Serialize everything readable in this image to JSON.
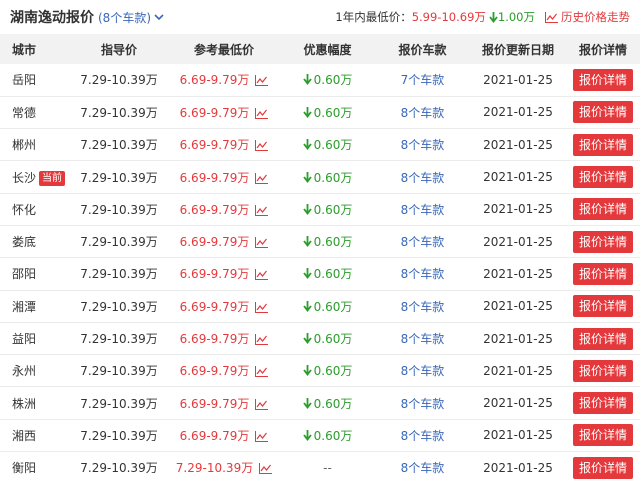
{
  "header": {
    "title": "湖南逸动报价",
    "model_count": "(8个车款)",
    "year_low_label": "1年内最低价：",
    "year_low_range": "5.99-10.69万",
    "year_drop": "1.00万",
    "history_link": "历史价格走势"
  },
  "colors": {
    "accent": "#e4393c",
    "link": "#3a67b8",
    "down": "#2a9d2a"
  },
  "columns": [
    "城市",
    "指导价",
    "参考最低价",
    "优惠幅度",
    "报价车款",
    "报价更新日期",
    "报价详情"
  ],
  "rows": [
    {
      "city": "岳阳",
      "badge": "",
      "guide": "7.29-10.39万",
      "low": "6.69-9.79万",
      "discount": "0.60万",
      "models": "7个车款",
      "date": "2021-01-25",
      "action": "报价详情"
    },
    {
      "city": "常德",
      "badge": "",
      "guide": "7.29-10.39万",
      "low": "6.69-9.79万",
      "discount": "0.60万",
      "models": "8个车款",
      "date": "2021-01-25",
      "action": "报价详情"
    },
    {
      "city": "郴州",
      "badge": "",
      "guide": "7.29-10.39万",
      "low": "6.69-9.79万",
      "discount": "0.60万",
      "models": "8个车款",
      "date": "2021-01-25",
      "action": "报价详情"
    },
    {
      "city": "长沙",
      "badge": "当前",
      "guide": "7.29-10.39万",
      "low": "6.69-9.79万",
      "discount": "0.60万",
      "models": "8个车款",
      "date": "2021-01-25",
      "action": "报价详情"
    },
    {
      "city": "怀化",
      "badge": "",
      "guide": "7.29-10.39万",
      "low": "6.69-9.79万",
      "discount": "0.60万",
      "models": "8个车款",
      "date": "2021-01-25",
      "action": "报价详情"
    },
    {
      "city": "娄底",
      "badge": "",
      "guide": "7.29-10.39万",
      "low": "6.69-9.79万",
      "discount": "0.60万",
      "models": "8个车款",
      "date": "2021-01-25",
      "action": "报价详情"
    },
    {
      "city": "邵阳",
      "badge": "",
      "guide": "7.29-10.39万",
      "low": "6.69-9.79万",
      "discount": "0.60万",
      "models": "8个车款",
      "date": "2021-01-25",
      "action": "报价详情"
    },
    {
      "city": "湘潭",
      "badge": "",
      "guide": "7.29-10.39万",
      "low": "6.69-9.79万",
      "discount": "0.60万",
      "models": "8个车款",
      "date": "2021-01-25",
      "action": "报价详情"
    },
    {
      "city": "益阳",
      "badge": "",
      "guide": "7.29-10.39万",
      "low": "6.69-9.79万",
      "discount": "0.60万",
      "models": "8个车款",
      "date": "2021-01-25",
      "action": "报价详情"
    },
    {
      "city": "永州",
      "badge": "",
      "guide": "7.29-10.39万",
      "low": "6.69-9.79万",
      "discount": "0.60万",
      "models": "8个车款",
      "date": "2021-01-25",
      "action": "报价详情"
    },
    {
      "city": "株洲",
      "badge": "",
      "guide": "7.29-10.39万",
      "low": "6.69-9.79万",
      "discount": "0.60万",
      "models": "8个车款",
      "date": "2021-01-25",
      "action": "报价详情"
    },
    {
      "city": "湘西",
      "badge": "",
      "guide": "7.29-10.39万",
      "low": "6.69-9.79万",
      "discount": "0.60万",
      "models": "8个车款",
      "date": "2021-01-25",
      "action": "报价详情"
    },
    {
      "city": "衡阳",
      "badge": "",
      "guide": "7.29-10.39万",
      "low": "7.29-10.39万",
      "discount": "--",
      "models": "8个车款",
      "date": "2021-01-25",
      "action": "报价详情"
    }
  ]
}
